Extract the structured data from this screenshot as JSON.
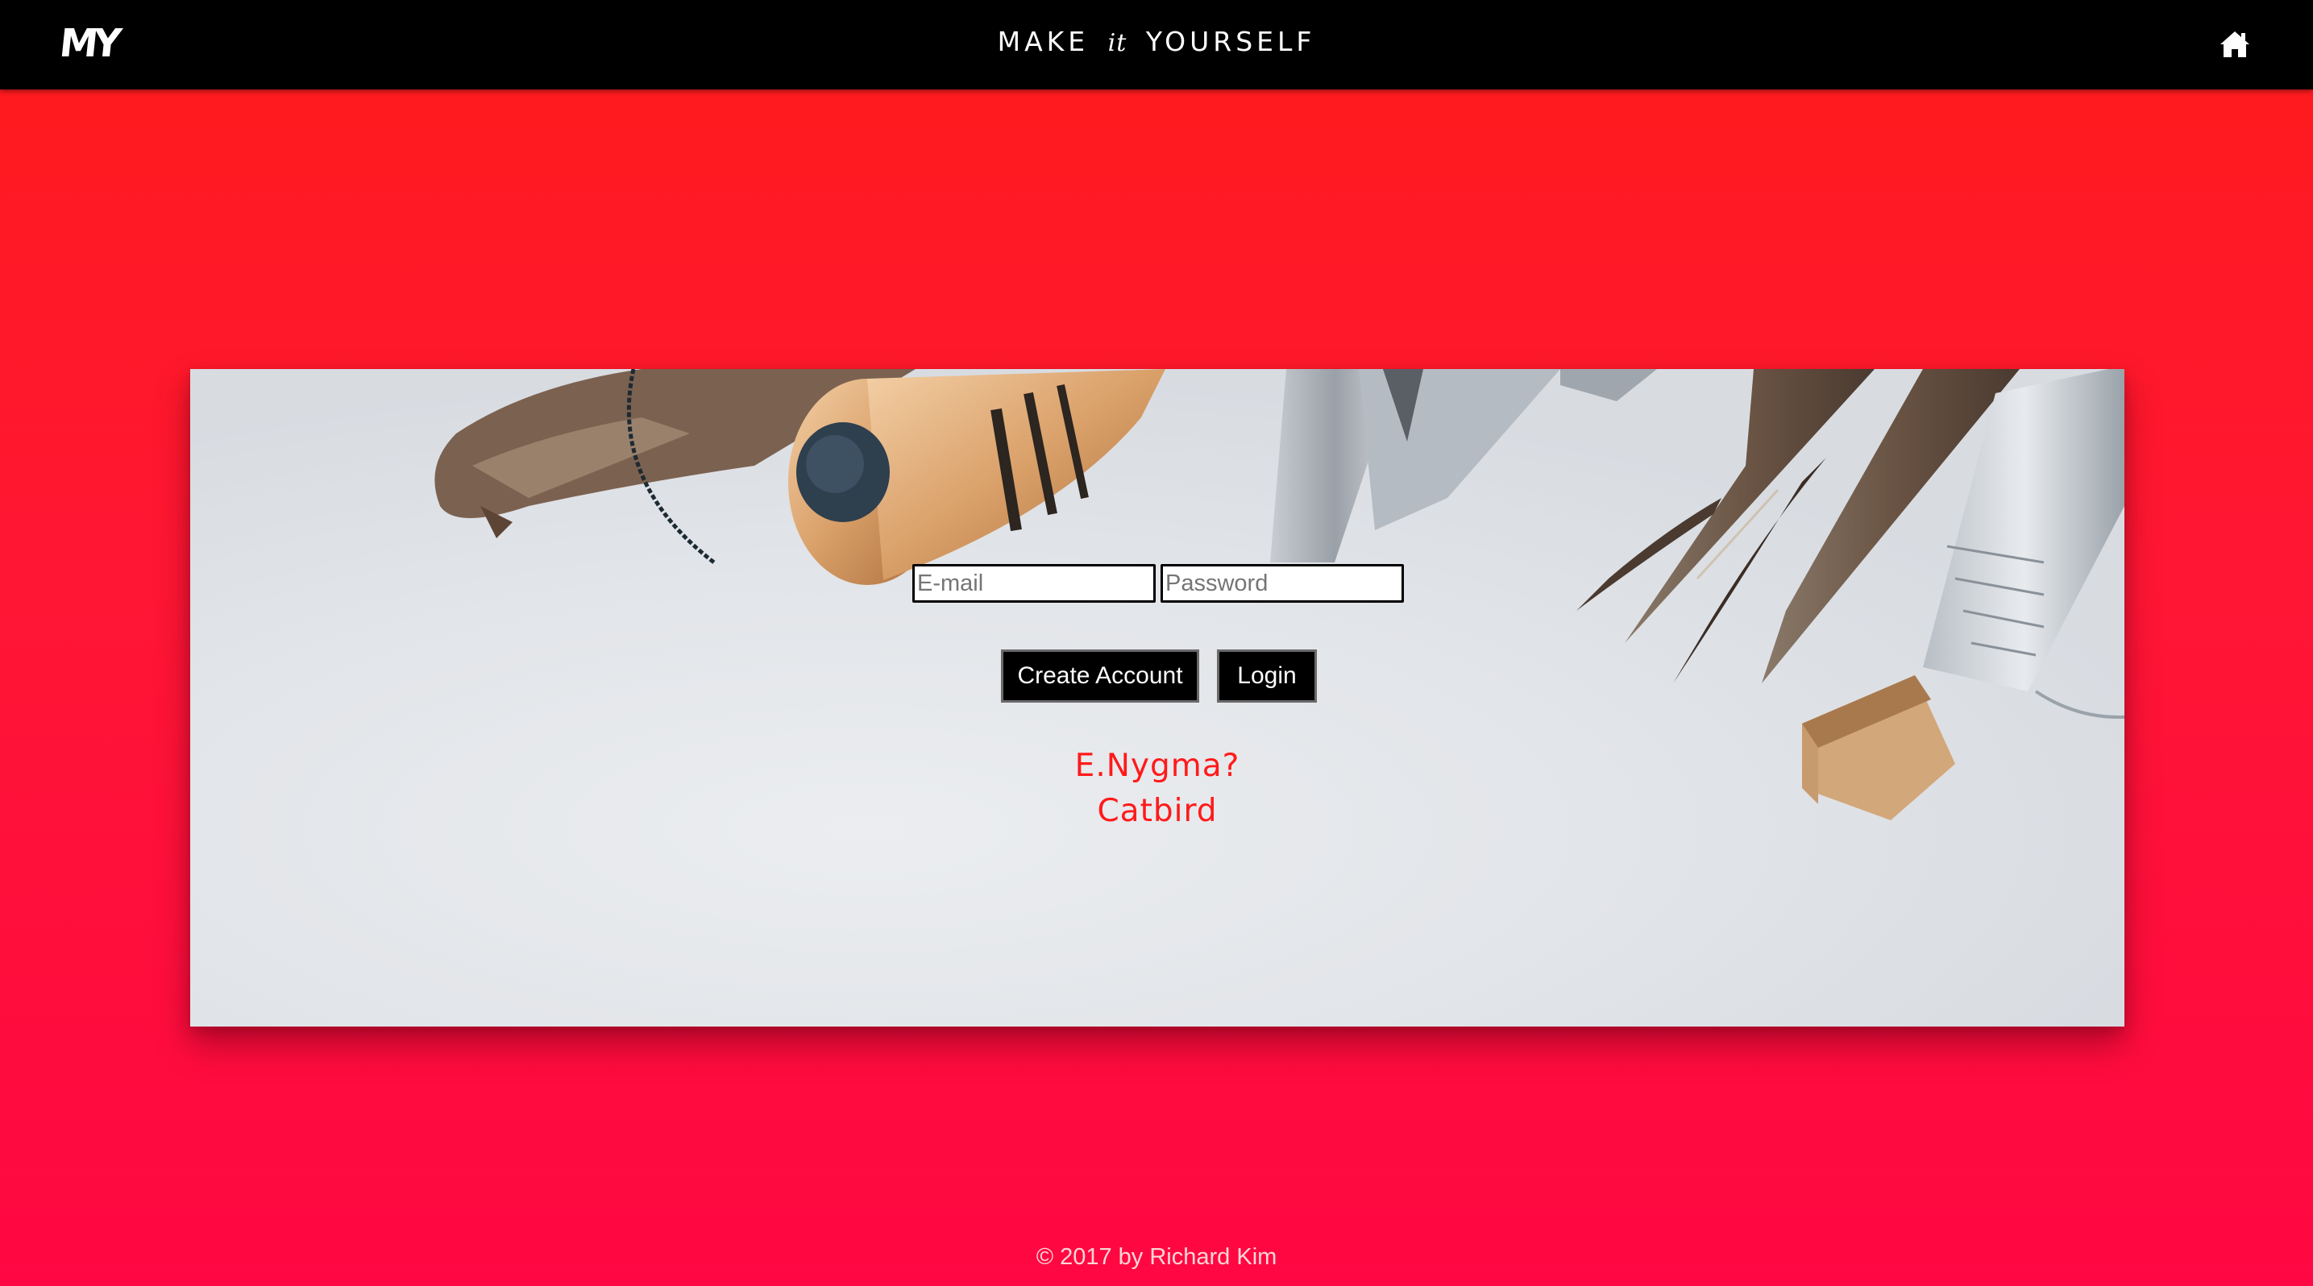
{
  "navbar": {
    "logo_text": "MY",
    "title_pre": "MAKE",
    "title_it": "it",
    "title_post": "YOURSELF",
    "home_icon": "home-icon"
  },
  "login": {
    "email_placeholder": "E-mail",
    "password_placeholder": "Password",
    "create_account_label": "Create Account",
    "login_label": "Login",
    "hint_line_1": "E.Nygma?",
    "hint_line_2": "Catbird"
  },
  "footer": {
    "copyright": "© 2017 by Richard Kim"
  },
  "colors": {
    "accent": "#ff1a1a",
    "navbar": "#000000",
    "background_top": "#ff1b1b",
    "background_bottom": "#ff0743"
  }
}
